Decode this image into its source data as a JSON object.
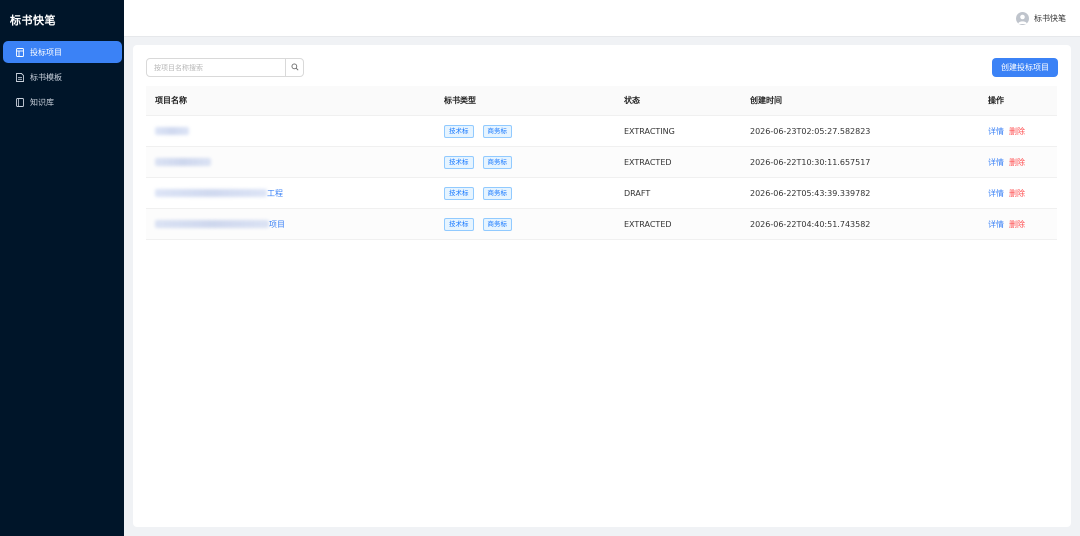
{
  "app": {
    "title": "标书快笔"
  },
  "sidebar": {
    "items": [
      {
        "label": "投标项目",
        "icon": "folder-icon",
        "active": true
      },
      {
        "label": "标书模板",
        "icon": "file-icon",
        "active": false
      },
      {
        "label": "知识库",
        "icon": "book-icon",
        "active": false
      }
    ]
  },
  "header": {
    "user_name": "标书快笔"
  },
  "toolbar": {
    "search_placeholder": "按项目名称搜索",
    "create_label": "创建投标项目"
  },
  "table": {
    "columns": [
      "项目名称",
      "标书类型",
      "状态",
      "创建时间",
      "操作"
    ],
    "rows": [
      {
        "name": "",
        "tags": [
          "技术标",
          "商务标"
        ],
        "status": "EXTRACTING",
        "created": "2026-06-23T02:05:27.582823",
        "ops": [
          "详情",
          "删除"
        ]
      },
      {
        "name": "",
        "tags": [
          "技术标",
          "商务标"
        ],
        "status": "EXTRACTED",
        "created": "2026-06-22T10:30:11.657517",
        "ops": [
          "详情",
          "删除"
        ]
      },
      {
        "name": "工程",
        "tags": [
          "技术标",
          "商务标"
        ],
        "status": "DRAFT",
        "created": "2026-06-22T05:43:39.339782",
        "ops": [
          "详情",
          "删除"
        ]
      },
      {
        "name": "项目",
        "tags": [
          "技术标",
          "商务标"
        ],
        "status": "EXTRACTED",
        "created": "2026-06-22T04:40:51.743582",
        "ops": [
          "详情",
          "删除"
        ]
      }
    ]
  },
  "colors": {
    "sidebar_bg": "#001529",
    "accent": "#3b82f6",
    "danger": "#ff4d4f"
  }
}
